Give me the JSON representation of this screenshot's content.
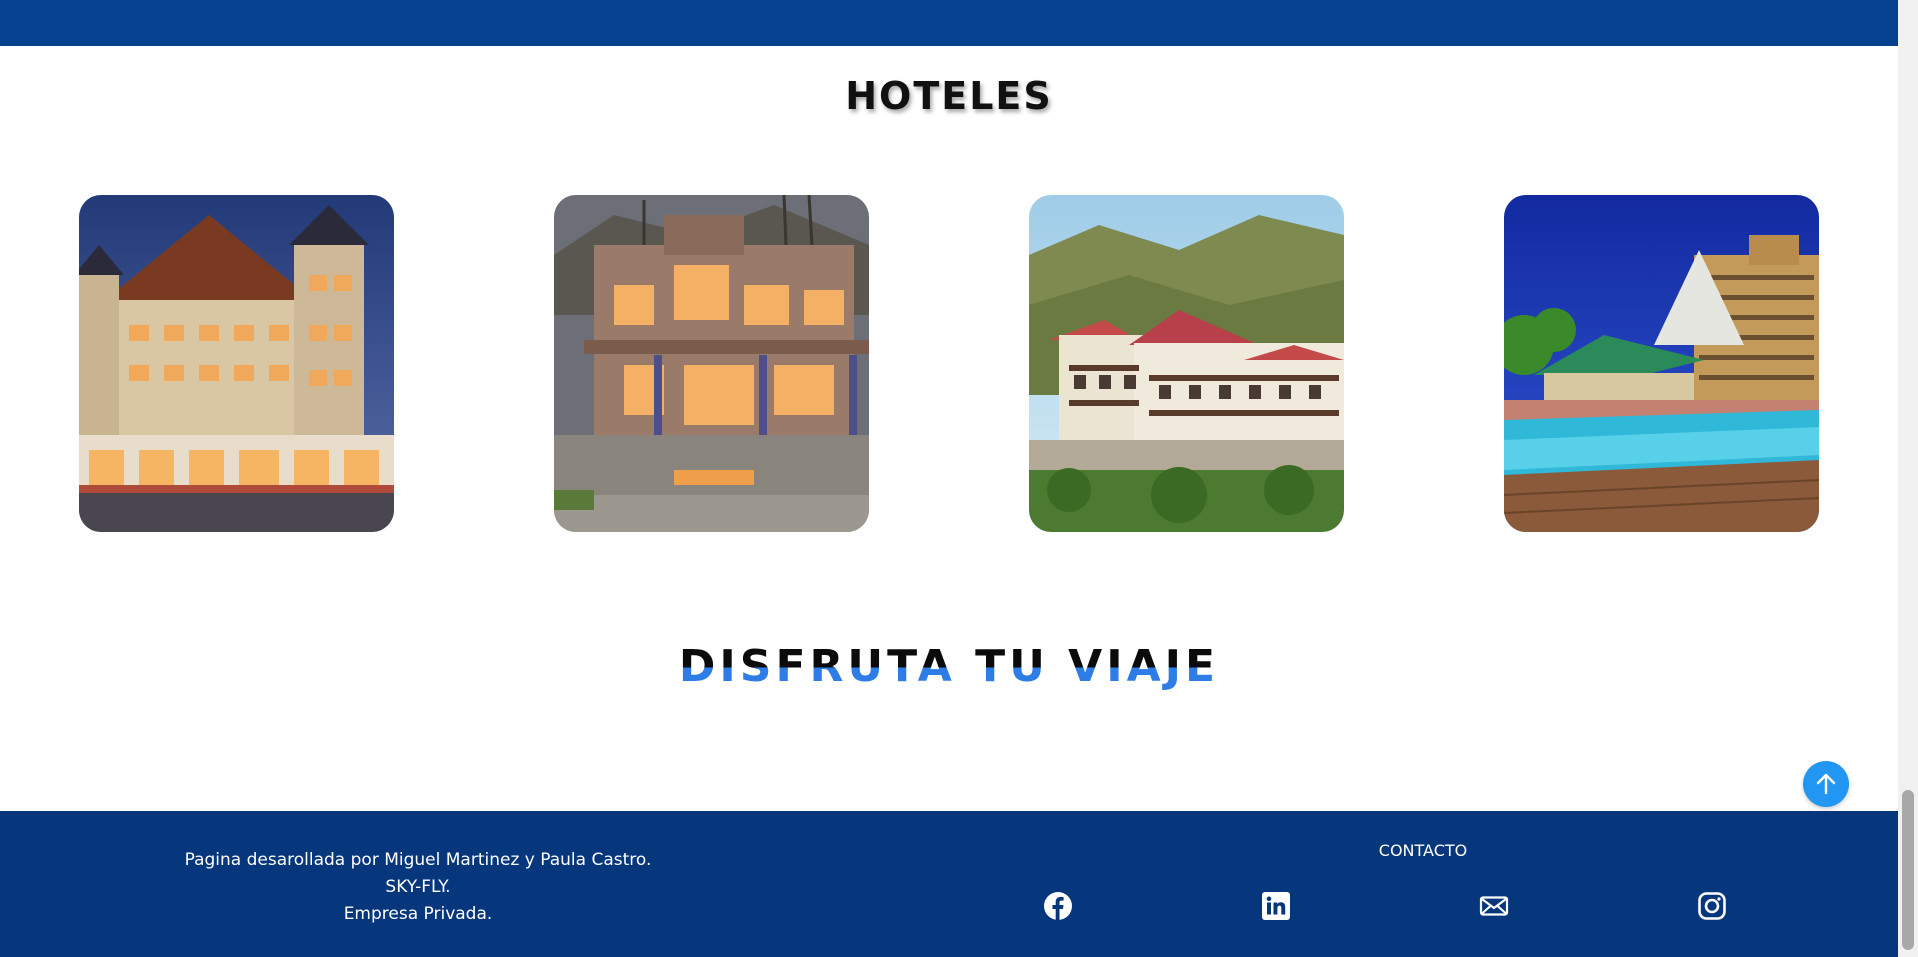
{
  "section": {
    "title": "HOTELES"
  },
  "hotels": [
    {
      "image": "hotel-alpine-chalet"
    },
    {
      "image": "hotel-stone-lodge"
    },
    {
      "image": "hotel-mountain-inn"
    },
    {
      "image": "hotel-pool-resort"
    }
  ],
  "slogan": "DISFRUTA TU VIAJE",
  "footer": {
    "credits": {
      "line1": "Pagina desarollada por Miguel Martinez y Paula Castro.",
      "line2": "SKY-FLY.",
      "line3": "Empresa Privada."
    },
    "contact_title": "CONTACTO",
    "social": [
      "facebook-icon",
      "linkedin-icon",
      "email-icon",
      "instagram-icon"
    ]
  },
  "colors": {
    "header": "#06418f",
    "footer": "#06367c",
    "accent": "#2196f3",
    "slogan_blue": "#2e7ce6"
  }
}
